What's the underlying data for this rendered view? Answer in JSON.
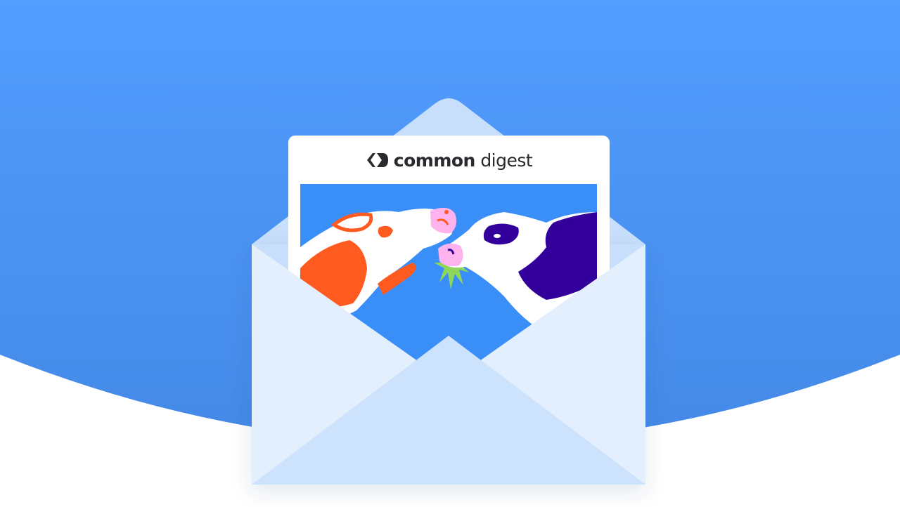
{
  "brand": {
    "name_bold": "common",
    "name_light": "digest",
    "logo_icon": "chevrons-logo-icon"
  },
  "colors": {
    "sky_top": "#529dff",
    "sky_bottom": "#4489e6",
    "envelope_body": "#e3effd",
    "envelope_flap": "#c7dffb",
    "illustration_bg": "#3a8ef8",
    "cow_left_spots": "#ff5a1f",
    "cow_right_spots": "#33009c",
    "snout_pink": "#ffb3ee",
    "grass_green": "#8fd65a"
  }
}
